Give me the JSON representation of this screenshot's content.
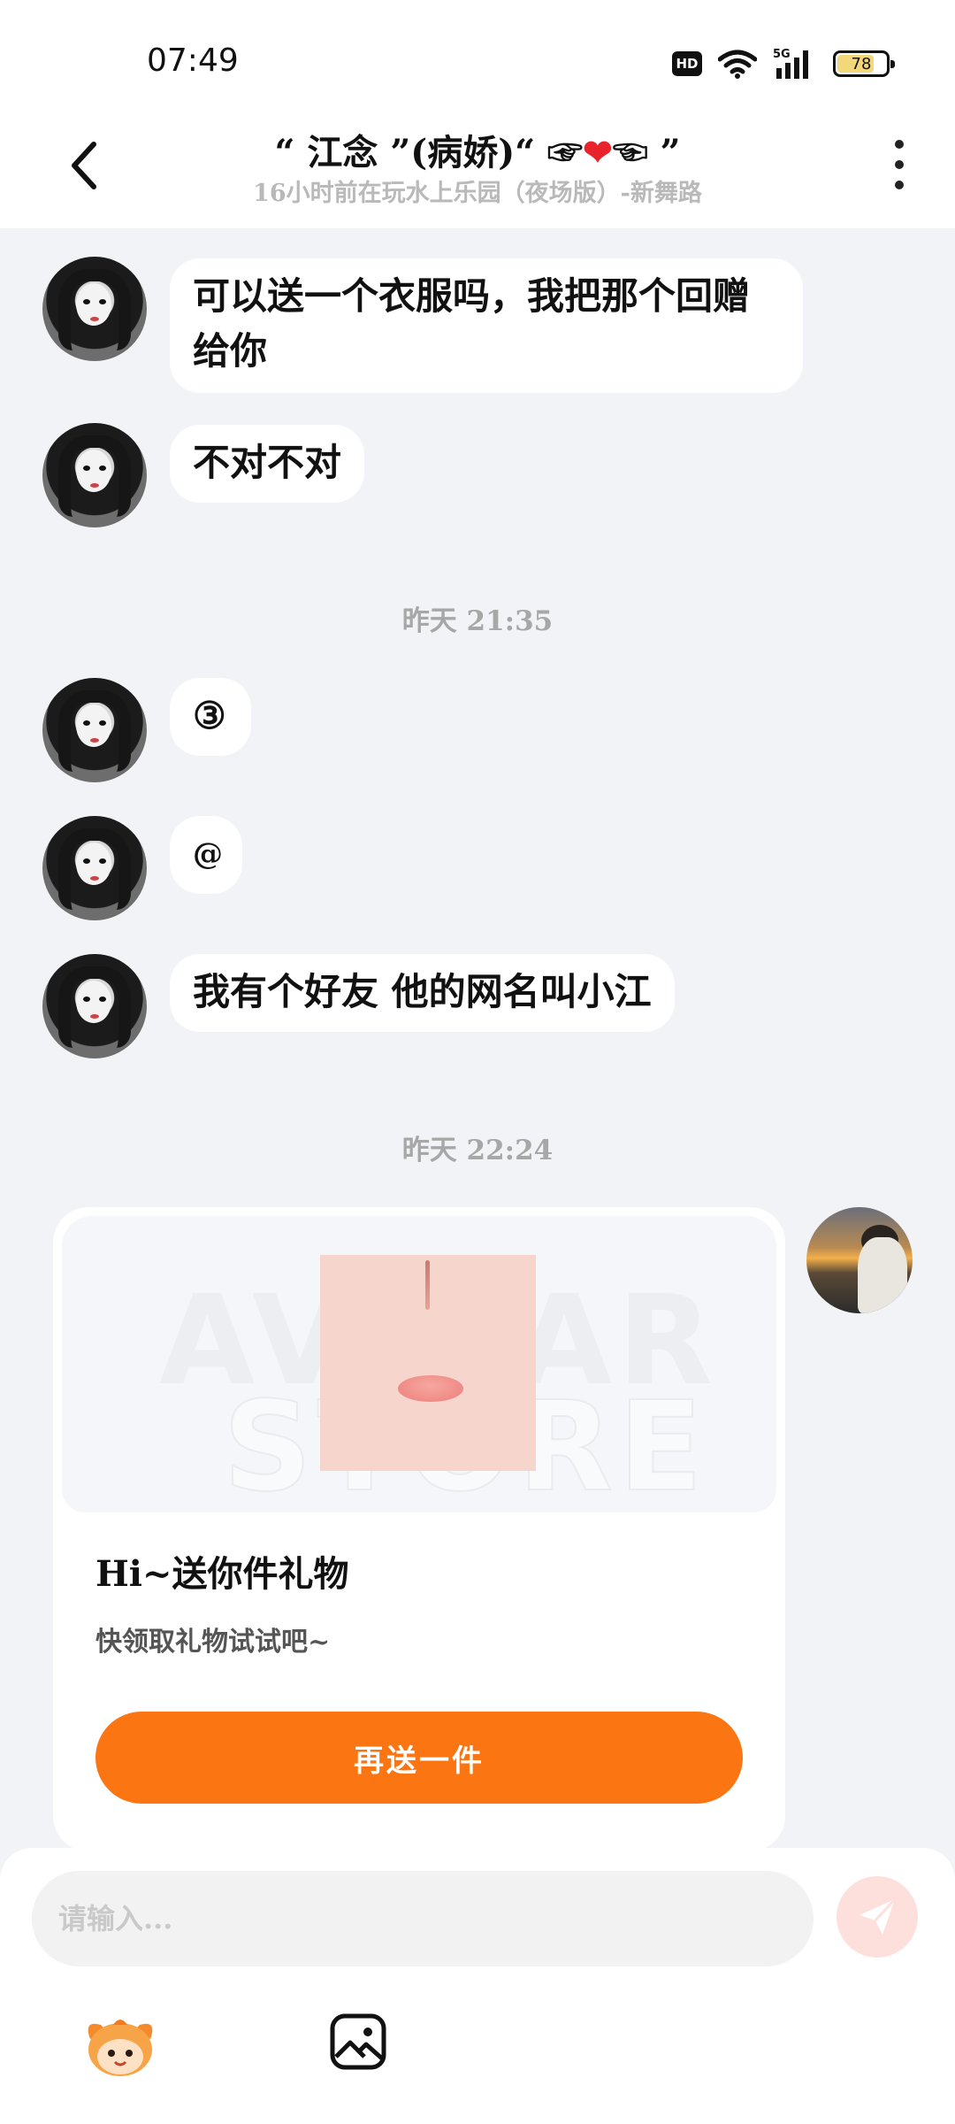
{
  "status_bar": {
    "time": "07:49",
    "hd": "HD",
    "network": "5G",
    "battery": "78",
    "battery_level": 0.78
  },
  "header": {
    "title_prefix": "“ 江念 ”(病娇)“ ☞",
    "title_heart": "❤",
    "title_suffix": "☜ ”",
    "subtitle": "16小时前在玩水上乐园（夜场版）-新舞路"
  },
  "messages": [
    {
      "text": "可以送一个衣服吗，我把那个回赠给你"
    },
    {
      "text": "不对不对"
    },
    {
      "text": "③"
    },
    {
      "text": "@"
    },
    {
      "text": "我有个好友 他的网名叫小江"
    }
  ],
  "time_labels": [
    "昨天 21:35",
    "昨天 22:24"
  ],
  "gift_card": {
    "watermark_line1": "AVATAR",
    "watermark_line2": "STORE",
    "title": "Hi~送你件礼物",
    "subtitle": "快领取礼物试试吧~",
    "button": "再送一件"
  },
  "composer": {
    "placeholder": "请输入..."
  },
  "colors": {
    "accent": "#fb7512",
    "background": "#f1f3f7",
    "send_disabled": "#fde0dc"
  },
  "icons": [
    "back-icon",
    "more-icon",
    "wifi-icon",
    "signal-icon",
    "send-icon",
    "mascot-icon",
    "image-icon"
  ]
}
